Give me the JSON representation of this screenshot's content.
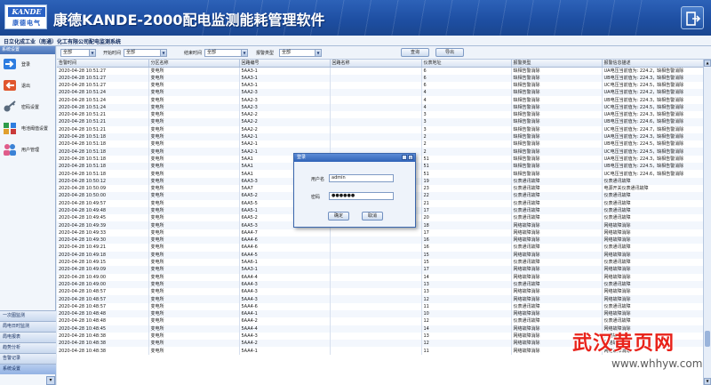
{
  "header": {
    "logo_brand": "KANDE",
    "logo_cn": "康德电气",
    "title": "康德KANDE-2000配电监测能耗管理软件"
  },
  "company": {
    "name": "日立化成工业（南通）化工有限公司配电监测系统"
  },
  "sidebar": {
    "head": "系统设置",
    "items": [
      {
        "label": "登录",
        "icon": "login-icon"
      },
      {
        "label": "退出",
        "icon": "logout-icon"
      },
      {
        "label": "密码设置",
        "icon": "key-icon"
      },
      {
        "label": "电池阈值设置",
        "icon": "battery-settings-icon"
      },
      {
        "label": "用户管理",
        "icon": "users-icon"
      }
    ],
    "nav": [
      "一次图监测",
      "局电日时监测",
      "局电报表",
      "趋势分析",
      "告警记录",
      "系统设置"
    ]
  },
  "filters": {
    "first_value": "全部",
    "start_label": "开始时间",
    "start_value": "全部",
    "end_label": "结束时间",
    "end_value": "全部",
    "type_label": "报警类型",
    "type_value": "全部",
    "query_button": "查询",
    "export_button": "导出"
  },
  "table": {
    "columns": [
      "告警时间",
      "分区名称",
      "回路编号",
      "回路名称",
      "仪表地址",
      "报警类型",
      "报警信息描述"
    ],
    "rows": [
      [
        "2020-04-28 10:51:27",
        "变电所",
        "5AA3-1",
        "",
        "6",
        "缺相告警消除",
        "UA电压当前值为: 224.2，缺相告警消除"
      ],
      [
        "2020-04-28 10:51:27",
        "变电所",
        "5AA3-1",
        "",
        "6",
        "缺相告警消除",
        "UB电压当前值为: 224.3，缺相告警消除"
      ],
      [
        "2020-04-28 10:51:27",
        "变电所",
        "5AA3-1",
        "",
        "6",
        "缺相告警消除",
        "UC电压当前值为: 224.5，缺相告警消除"
      ],
      [
        "2020-04-28 10:51:24",
        "变电所",
        "5AA2-3",
        "",
        "4",
        "缺相告警消除",
        "UA电压当前值为: 224.2，缺相告警消除"
      ],
      [
        "2020-04-28 10:51:24",
        "变电所",
        "5AA2-3",
        "",
        "4",
        "缺相告警消除",
        "UB电压当前值为: 224.3，缺相告警消除"
      ],
      [
        "2020-04-28 10:51:24",
        "变电所",
        "5AA2-3",
        "",
        "4",
        "缺相告警消除",
        "UC电压当前值为: 224.5，缺相告警消除"
      ],
      [
        "2020-04-28 10:51:21",
        "变电所",
        "5AA2-2",
        "",
        "3",
        "缺相告警消除",
        "UA电压当前值为: 224.3，缺相告警消除"
      ],
      [
        "2020-04-28 10:51:21",
        "变电所",
        "5AA2-2",
        "",
        "3",
        "缺相告警消除",
        "UB电压当前值为: 224.6，缺相告警消除"
      ],
      [
        "2020-04-28 10:51:21",
        "变电所",
        "5AA2-2",
        "",
        "3",
        "缺相告警消除",
        "UC电压当前值为: 224.7，缺相告警消除"
      ],
      [
        "2020-04-28 10:51:18",
        "变电所",
        "5AA2-1",
        "",
        "2",
        "缺相告警消除",
        "UA电压当前值为: 224.3，缺相告警消除"
      ],
      [
        "2020-04-28 10:51:18",
        "变电所",
        "5AA2-1",
        "",
        "2",
        "缺相告警消除",
        "UB电压当前值为: 224.5，缺相告警消除"
      ],
      [
        "2020-04-28 10:51:18",
        "变电所",
        "5AA2-1",
        "",
        "2",
        "缺相告警消除",
        "UC电压当前值为: 224.5，缺相告警消除"
      ],
      [
        "2020-04-28 10:51:18",
        "变电所",
        "5AA1",
        "",
        "51",
        "缺相告警消除",
        "UA电压当前值为: 224.3，缺相告警消除"
      ],
      [
        "2020-04-28 10:51:18",
        "变电所",
        "5AA1",
        "",
        "51",
        "缺相告警消除",
        "UB电压当前值为: 224.5，缺相告警消除"
      ],
      [
        "2020-04-28 10:51:18",
        "变电所",
        "5AA1",
        "",
        "51",
        "缺相告警消除",
        "UC电压当前值为: 224.6，缺相告警消除"
      ],
      [
        "2020-04-28 10:50:12",
        "变电所",
        "6AA3-3",
        "",
        "19",
        "仪表通讯故障",
        "仪表通讯故障"
      ],
      [
        "2020-04-28 10:50:09",
        "变电所",
        "5AA7",
        "",
        "23",
        "仪表通讯故障",
        "电源开关仪表通讯故障"
      ],
      [
        "2020-04-28 10:50:00",
        "变电所",
        "6AA5-2",
        "",
        "22",
        "仪表通讯故障",
        "仪表通讯故障"
      ],
      [
        "2020-04-28 10:49:57",
        "变电所",
        "6AA5-5",
        "",
        "21",
        "仪表通讯故障",
        "仪表通讯故障"
      ],
      [
        "2020-04-28 10:49:48",
        "变电所",
        "6AA5-1",
        "",
        "17",
        "仪表通讯故障",
        "仪表通讯故障"
      ],
      [
        "2020-04-28 10:49:45",
        "变电所",
        "6AA5-2",
        "",
        "20",
        "仪表通讯故障",
        "仪表通讯故障"
      ],
      [
        "2020-04-28 10:49:39",
        "变电所",
        "6AA5-3",
        "",
        "18",
        "网络故障消除",
        "网络故障消除"
      ],
      [
        "2020-04-28 10:49:33",
        "变电所",
        "6AA4-7",
        "",
        "17",
        "网络故障消除",
        "网络故障消除"
      ],
      [
        "2020-04-28 10:49:30",
        "变电所",
        "6AA4-6",
        "",
        "16",
        "网络故障消除",
        "网络故障消除"
      ],
      [
        "2020-04-28 10:49:21",
        "变电所",
        "6AA4-6",
        "",
        "16",
        "仪表通讯故障",
        "仪表通讯故障"
      ],
      [
        "2020-04-28 10:49:18",
        "变电所",
        "6AA4-5",
        "",
        "15",
        "网络故障消除",
        "网络故障消除"
      ],
      [
        "2020-04-28 10:49:15",
        "变电所",
        "5AA6-1",
        "",
        "15",
        "仪表通讯故障",
        "仪表通讯故障"
      ],
      [
        "2020-04-28 10:49:09",
        "变电所",
        "5AA3-1",
        "",
        "17",
        "网络故障消除",
        "网络故障消除"
      ],
      [
        "2020-04-28 10:49:00",
        "变电所",
        "6AA4-4",
        "",
        "14",
        "网络故障消除",
        "网络故障消除"
      ],
      [
        "2020-04-28 10:49:00",
        "变电所",
        "6AA4-3",
        "",
        "13",
        "仪表通讯故障",
        "仪表通讯故障"
      ],
      [
        "2020-04-28 10:48:57",
        "变电所",
        "6AA4-3",
        "",
        "13",
        "网络故障消除",
        "网络故障消除"
      ],
      [
        "2020-04-28 10:48:57",
        "变电所",
        "5AA4-3",
        "",
        "12",
        "网络故障消除",
        "网络故障消除"
      ],
      [
        "2020-04-28 10:48:57",
        "变电所",
        "5AA4-6",
        "",
        "11",
        "仪表通讯故障",
        "仪表通讯故障"
      ],
      [
        "2020-04-28 10:48:48",
        "变电所",
        "6AA4-1",
        "",
        "10",
        "网络故障消除",
        "网络故障消除"
      ],
      [
        "2020-04-28 10:48:48",
        "变电所",
        "6AA4-2",
        "",
        "12",
        "仪表通讯故障",
        "仪表通讯故障"
      ],
      [
        "2020-04-28 10:48:45",
        "变电所",
        "5AA4-4",
        "",
        "14",
        "网络故障消除",
        "网络故障消除"
      ],
      [
        "2020-04-28 10:48:38",
        "变电所",
        "5AA4-3",
        "",
        "13",
        "网络故障消除",
        "网络故障消除"
      ],
      [
        "2020-04-28 10:48:38",
        "变电所",
        "5AA4-2",
        "",
        "12",
        "网络故障消除",
        "网络故障消除"
      ],
      [
        "2020-04-28 10:48:38",
        "变电所",
        "5AA4-1",
        "",
        "11",
        "网络故障消除",
        "网络故障消除"
      ]
    ]
  },
  "dialog": {
    "title": "登录",
    "user_label": "用户名",
    "user_value": "admin",
    "password_label": "密码",
    "password_value": "●●●●●●",
    "ok": "确定",
    "cancel": "取消"
  },
  "watermark": {
    "text": "武汉黄页网",
    "url": "www.whhyw.com"
  }
}
